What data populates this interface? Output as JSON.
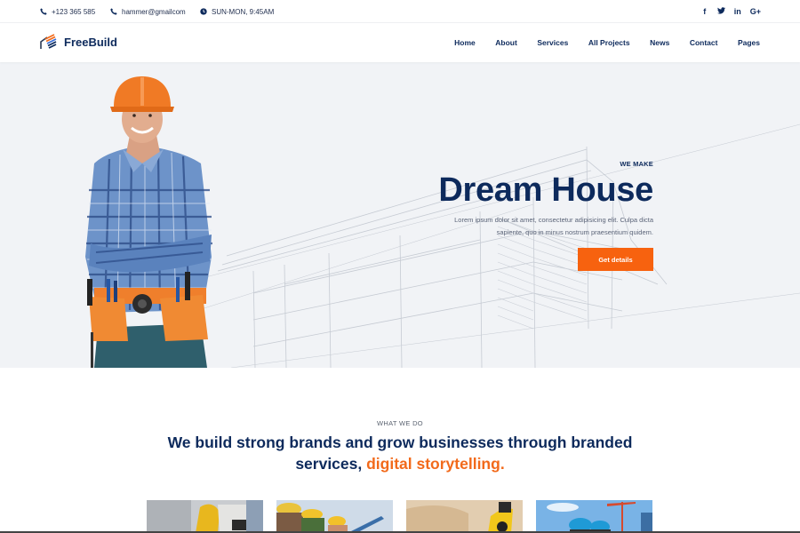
{
  "topbar": {
    "phone": "+123 365 585",
    "email": "hammer@gmailcom",
    "hours": "SUN-MON, 9:45AM",
    "social": [
      {
        "icon": "facebook-icon",
        "glyph": "f"
      },
      {
        "icon": "twitter-icon",
        "glyph": "🐦"
      },
      {
        "icon": "linkedin-icon",
        "glyph": "in"
      },
      {
        "icon": "google-plus-icon",
        "glyph": "G+"
      }
    ]
  },
  "header": {
    "brand": "FreeBuild",
    "nav": [
      "Home",
      "About",
      "Services",
      "All Projects",
      "News",
      "Contact",
      "Pages"
    ]
  },
  "hero": {
    "eyebrow": "WE MAKE",
    "title": "Dream House",
    "description_line1": "Lorem ipsum dolor sit amet, consectetur adipisicing elit. Culpa dicta",
    "description_line2": "sapiente, quo in minus nostrum praesentium quidem.",
    "cta_label": "Get details"
  },
  "what_we_do": {
    "eyebrow": "WHAT WE DO",
    "title_line1": "We build strong brands and grow businesses through branded",
    "title_line2_plain": "services, ",
    "title_line2_accent": "digital storytelling."
  },
  "thumbnails": [
    {
      "name": "worker-tools-thumb"
    },
    {
      "name": "engineers-hardhats-thumb"
    },
    {
      "name": "excavator-thumb"
    },
    {
      "name": "crane-workers-thumb"
    }
  ],
  "colors": {
    "navy": "#0d2a5c",
    "orange": "#f7620f",
    "accent_text": "#f26a1b",
    "hero_bg": "#f1f3f6"
  }
}
